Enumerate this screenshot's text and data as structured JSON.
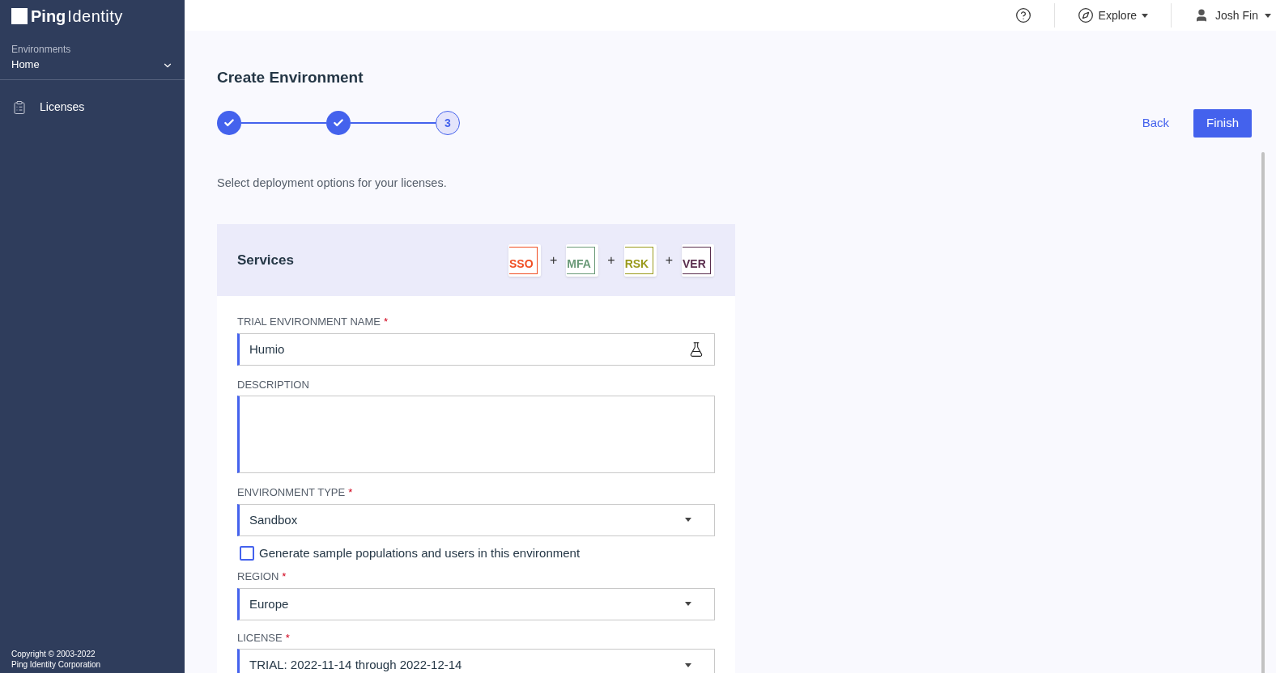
{
  "sidebar": {
    "logo": {
      "bold": "Ping",
      "light": "Identity"
    },
    "environment_label": "Environments",
    "environment": "Home",
    "items": [
      {
        "label": "Licenses",
        "selected": false
      }
    ],
    "footer": [
      "Copyright © 2003-2022",
      "Ping Identity Corporation"
    ]
  },
  "topbar": {
    "explore": "Explore",
    "user": "Josh Fin"
  },
  "page": {
    "title": "Create Environment",
    "steps": [
      {
        "completed": true
      },
      {
        "completed": true
      },
      {
        "label": "3",
        "completed": false
      }
    ],
    "back": "Back",
    "finish": "Finish",
    "subtitle": "Select deployment options for your licenses."
  },
  "services": {
    "title": "Services",
    "separator": "+",
    "badges": [
      {
        "label": "SSO",
        "color": "#f04e23"
      },
      {
        "label": "MFA",
        "color": "#6a9a78"
      },
      {
        "label": "RSK",
        "color": "#9a9a1c"
      },
      {
        "label": "VER",
        "color": "#5a2e4e"
      }
    ]
  },
  "fields": [
    {
      "kind": "text",
      "label": "TRIAL ENVIRONMENT NAME",
      "required_mark": "*",
      "value": "Humio"
    },
    {
      "kind": "textarea",
      "label": "DESCRIPTION"
    },
    {
      "kind": "select",
      "label": "ENVIRONMENT TYPE",
      "required_mark": "*",
      "value": "Sandbox"
    },
    {
      "kind": "checkbox",
      "label": "Generate sample populations and users in this environment",
      "checked": false
    },
    {
      "kind": "select",
      "label": "REGION",
      "required_mark": "*",
      "value": "Europe"
    },
    {
      "kind": "select",
      "label": "LICENSE",
      "required_mark": "*",
      "value": "TRIAL: 2022-11-14 through 2022-12-14"
    }
  ]
}
